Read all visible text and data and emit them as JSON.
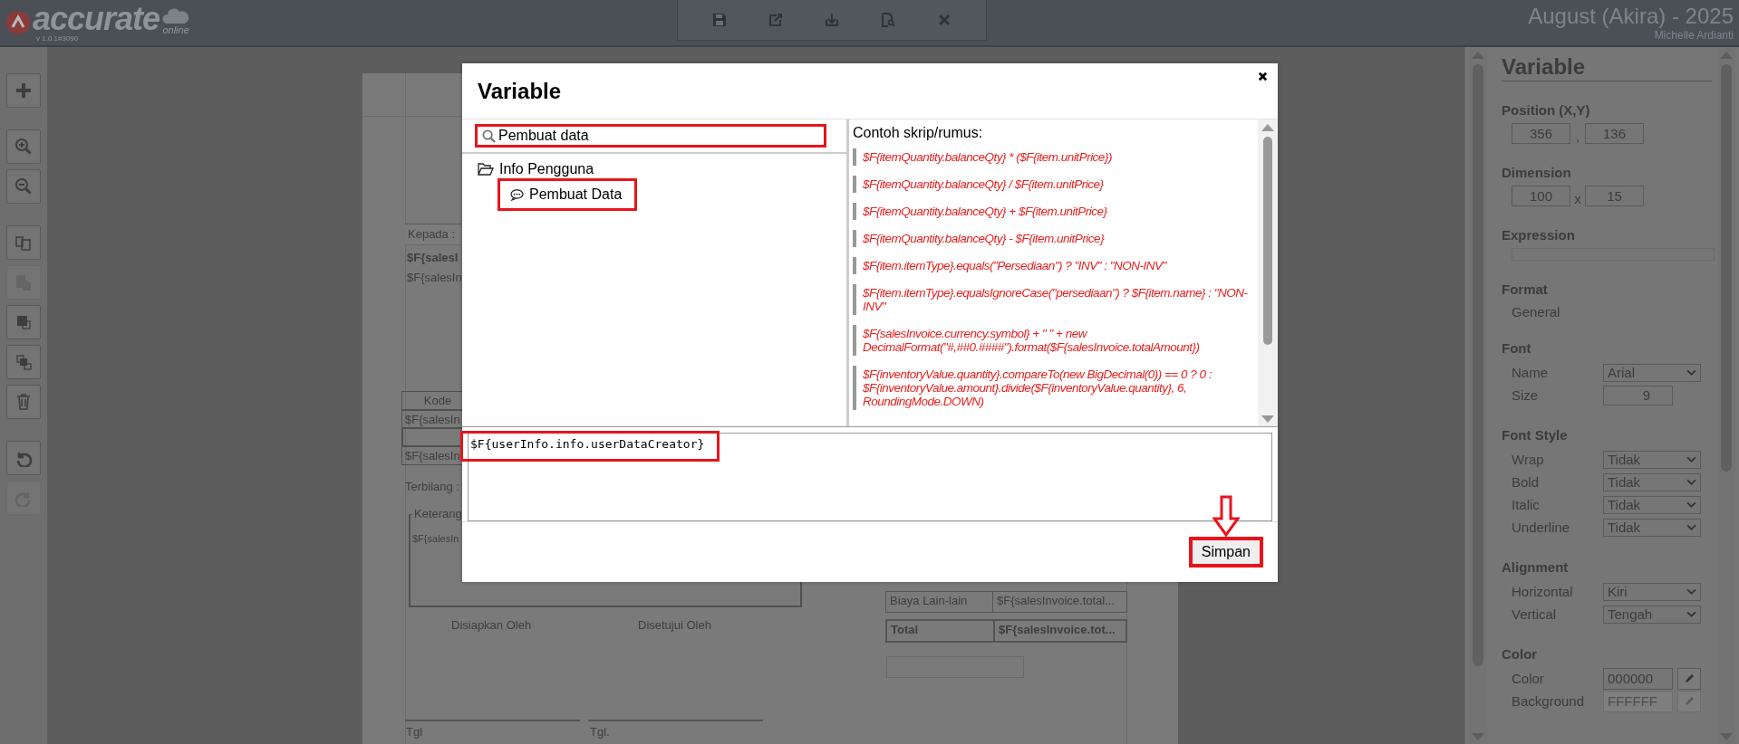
{
  "app": {
    "logo": "accurate",
    "logo_sub": "online",
    "version": "v 1.0.1#3090",
    "company": "August (Akira) - 2025",
    "user": "Michelle Ardianti"
  },
  "document": {
    "recipient_label": "Kepada :",
    "recipient_lines": [
      {
        "text": "$F{salesI",
        "bold": true
      },
      {
        "text": "$F{salesIn",
        "bold": false
      }
    ],
    "item_table": {
      "header": "Kode",
      "cell": "$F{salesIn"
    },
    "second_table": {
      "cell": "$F{salesIn"
    },
    "amount_in_words_label": "Terbilang :",
    "notes": {
      "legend": "Keterang",
      "text": "$F{salesIn"
    },
    "signatures": [
      {
        "label": "Disiapkan Oleh",
        "date_label": "Tgl"
      },
      {
        "label": "Disetujui Oleh",
        "date_label": "Tgl."
      }
    ],
    "totals": [
      {
        "label": "Biaya Lain-lain",
        "value": "$F{salesInvoice.total...",
        "bold": false
      },
      {
        "label": "Total",
        "value": "$F{salesInvoice.tot...",
        "bold": true
      }
    ]
  },
  "properties_panel": {
    "title": "Variable",
    "sections": [
      {
        "heading": "Position (X,Y)",
        "kind": "pair",
        "values": [
          "356",
          "136"
        ],
        "separator": ","
      },
      {
        "heading": "Dimension",
        "kind": "pair",
        "values": [
          "100",
          "15"
        ],
        "separator": "x"
      },
      {
        "heading": "Expression",
        "kind": "field"
      },
      {
        "heading": "Format",
        "kind": "text",
        "text": "General"
      },
      {
        "heading": "Font",
        "kind": "rows",
        "rows": [
          {
            "label": "Name",
            "kind": "select",
            "value": "Arial"
          },
          {
            "label": "Size",
            "kind": "number",
            "value": "9"
          }
        ]
      },
      {
        "heading": "Font Style",
        "kind": "rows",
        "rows": [
          {
            "label": "Wrap",
            "kind": "select",
            "value": "Tidak"
          },
          {
            "label": "Bold",
            "kind": "select",
            "value": "Tidak"
          },
          {
            "label": "Italic",
            "kind": "select",
            "value": "Tidak"
          },
          {
            "label": "Underline",
            "kind": "select",
            "value": "Tidak"
          }
        ]
      },
      {
        "heading": "Alignment",
        "kind": "rows",
        "rows": [
          {
            "label": "Horizontal",
            "kind": "select",
            "value": "Kiri"
          },
          {
            "label": "Vertical",
            "kind": "select",
            "value": "Tengah"
          }
        ]
      },
      {
        "heading": "Color",
        "kind": "rows",
        "rows": [
          {
            "label": "Color",
            "kind": "color",
            "value": "000000",
            "disabled": false
          },
          {
            "label": "Background",
            "kind": "color",
            "value": "FFFFFF",
            "disabled": true
          }
        ]
      }
    ]
  },
  "dialog": {
    "title": "Variable",
    "search": {
      "value": "Pembuat data",
      "highlighted": true
    },
    "tree": [
      {
        "label": "Info Pengguna",
        "expanded": true,
        "children": [
          {
            "label": "Pembuat Data",
            "highlighted": true
          }
        ]
      }
    ],
    "examples_title": "Contoh skrip/rumus:",
    "examples": [
      "$F{itemQuantity.balanceQty} * ($F{item.unitPrice})",
      "$F{itemQuantity.balanceQty} / $F{item.unitPrice}",
      "$F{itemQuantity.balanceQty} + $F{item.unitPrice}",
      "$F{itemQuantity.balanceQty} - $F{item.unitPrice}",
      "$F{item.itemType}.equals(\"Persediaan\") ? \"INV\" : \"NON-INV\"",
      "$F{item.itemType}.equalsIgnoreCase(\"persediaan\") ? $F{item.name} : \"NON-INV\"",
      "$F{salesInvoice.currency.symbol} + \" \" + new DecimalFormat(\"#,##0.####\").format($F{salesInvoice.totalAmount})",
      "$F{inventoryValue.quantity}.compareTo(new BigDecimal(0)) == 0 ? 0 : $F{inventoryValue.amount}.divide($F{inventoryValue.quantity}, 6, RoundingMode.DOWN)"
    ],
    "expression": {
      "value": "$F{userInfo.info.userDataCreator}",
      "highlighted": true
    },
    "save_button": {
      "label": "Simpan",
      "highlighted": true,
      "pointer_arrow": true
    }
  }
}
